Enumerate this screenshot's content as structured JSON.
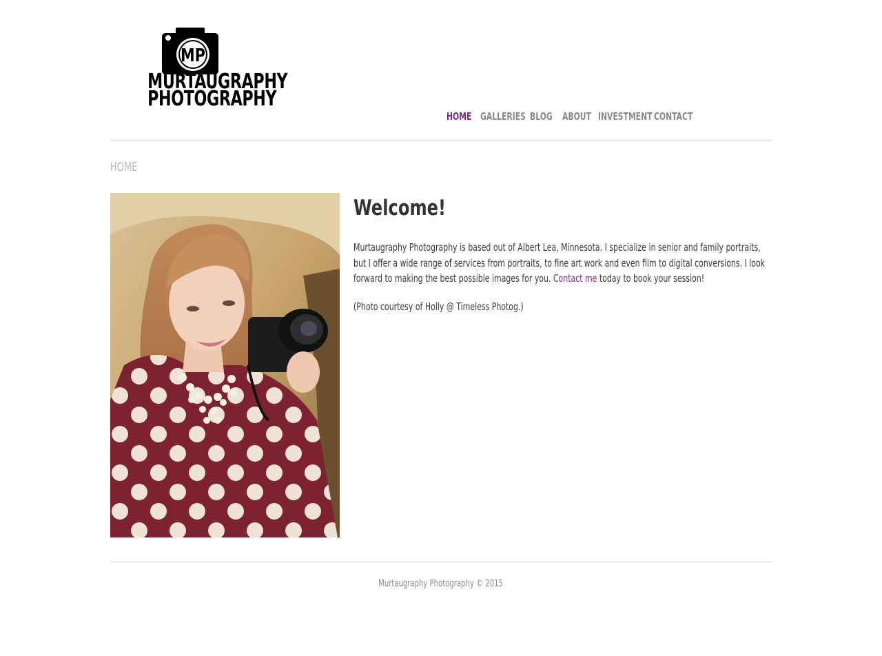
{
  "brand": {
    "logo_initials": "MP",
    "logo_line1": "MURTAUGRAPHY",
    "logo_line2": "PHOTOGRAPHY"
  },
  "nav": {
    "items": [
      {
        "label": "HOME",
        "active": true
      },
      {
        "label": "GALLERIES",
        "active": false
      },
      {
        "label": "BLOG",
        "active": false
      },
      {
        "label": "ABOUT",
        "active": false
      },
      {
        "label": "INVESTMENT",
        "active": false
      },
      {
        "label": "CONTACT",
        "active": false
      }
    ]
  },
  "breadcrumb": "HOME",
  "main": {
    "title": "Welcome!",
    "paragraph_before_link": "Murtaugraphy Photography is based out of Albert Lea, Minnesota. I specialize in senior and family portraits, but I offer a wide range of services from portraits, to fine art work and even film to digital conversions. I look forward to making the best possible images for you. ",
    "link_text": "Contact me",
    "paragraph_after_link": " today to book your session!",
    "credit": "(Photo courtesy of Holly @ Timeless Photog.)"
  },
  "footer": {
    "copyright": "Murtaugraphy Photography © 2015"
  },
  "colors": {
    "accent": "#7b2a86",
    "nav_text": "#8a8a8a",
    "body_text": "#3a3a3a",
    "rule": "#cfcfcf"
  }
}
